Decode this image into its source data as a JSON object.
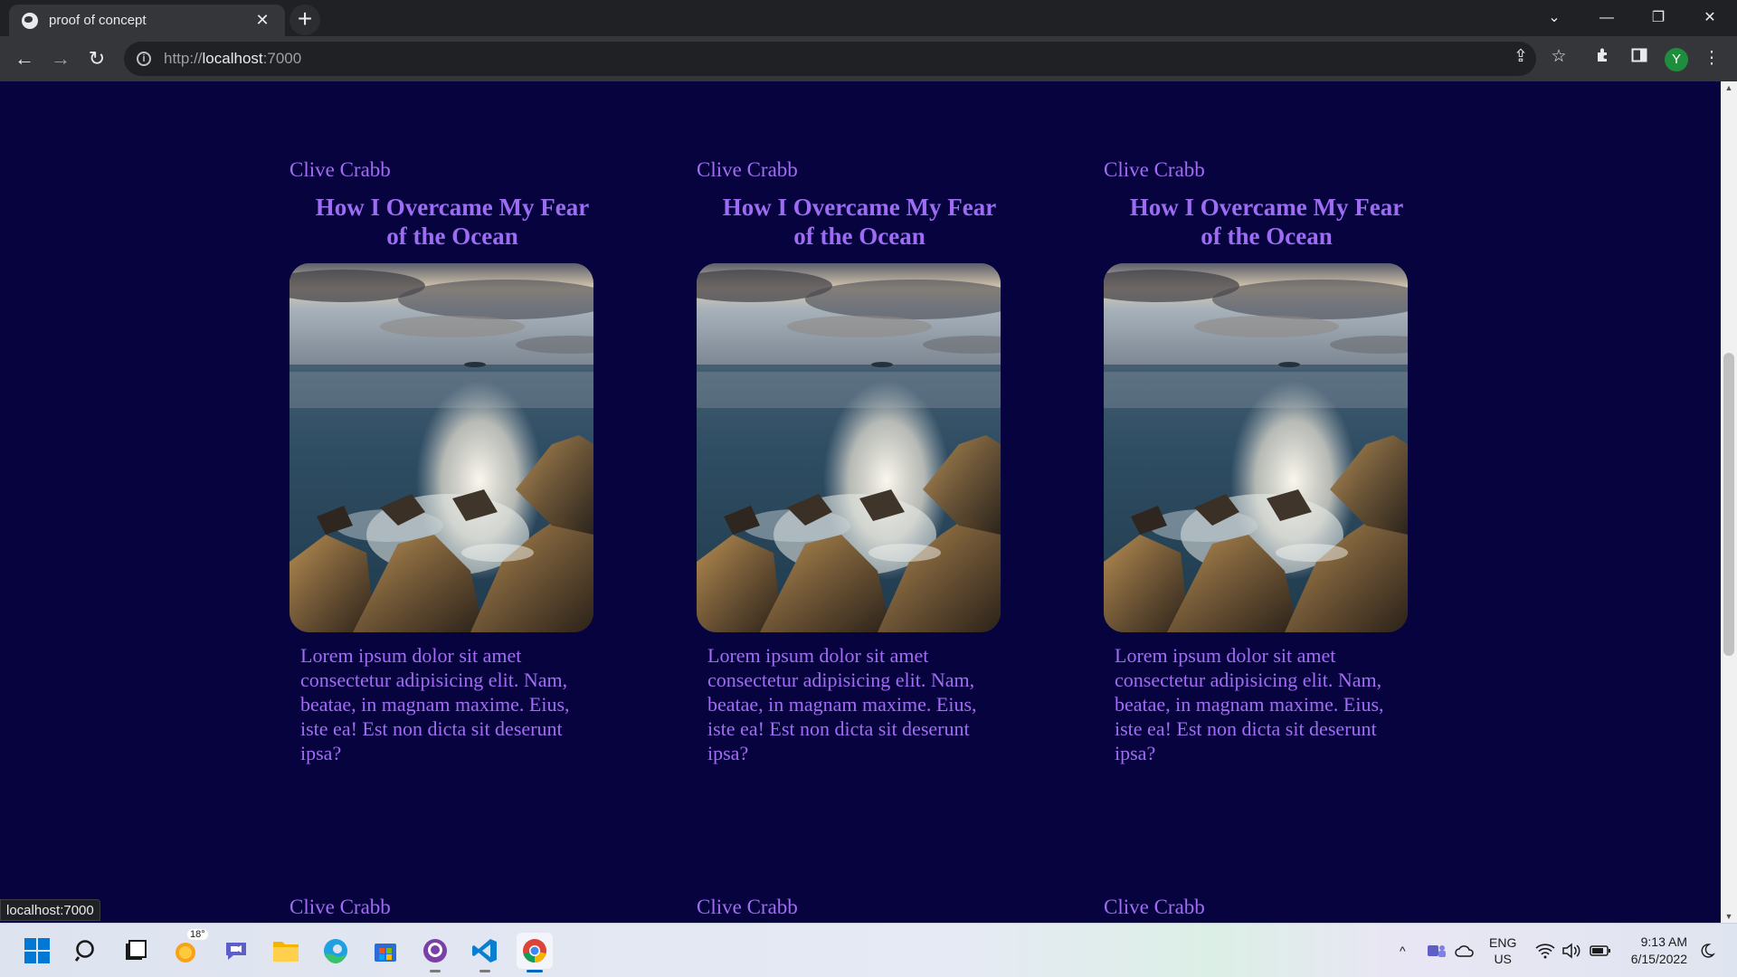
{
  "browser": {
    "tab_title": "proof of concept",
    "tab_close": "✕",
    "new_tab": "+",
    "url_prefix": "http://",
    "url_host": "localhost",
    "url_port": ":7000",
    "profile_initial": "Y",
    "status_url": "localhost:7000",
    "icons": [
      "back-icon",
      "forward-icon",
      "reload-icon",
      "info-icon",
      "share-icon",
      "star-icon",
      "extensions-icon",
      "side-panel-icon",
      "menu-icon"
    ]
  },
  "cards_row1": [
    {
      "author": "Clive Crabb",
      "title": "How I Overcame My Fear of the Ocean",
      "text": "Lorem ipsum dolor sit amet consectetur adipisicing elit. Nam, beatae, in magnam maxime. Eius, iste ea! Est non dicta sit deserunt ipsa?"
    },
    {
      "author": "Clive Crabb",
      "title": "How I Overcame My Fear of the Ocean",
      "text": "Lorem ipsum dolor sit amet consectetur adipisicing elit. Nam, beatae, in magnam maxime. Eius, iste ea! Est non dicta sit deserunt ipsa?"
    },
    {
      "author": "Clive Crabb",
      "title": "How I Overcame My Fear of the Ocean",
      "text": "Lorem ipsum dolor sit amet consectetur adipisicing elit. Nam, beatae, in magnam maxime. Eius, iste ea! Est non dicta sit deserunt ipsa?"
    }
  ],
  "cards_row2": [
    {
      "author": "Clive Crabb"
    },
    {
      "author": "Clive Crabb"
    },
    {
      "author": "Clive Crabb"
    }
  ],
  "taskbar": {
    "weather_temp": "18°",
    "lang_top": "ENG",
    "lang_bottom": "US",
    "time": "9:13 AM",
    "date": "6/15/2022"
  },
  "colors": {
    "page_bg": "#06033f",
    "text_purple": "#a36cf4"
  }
}
